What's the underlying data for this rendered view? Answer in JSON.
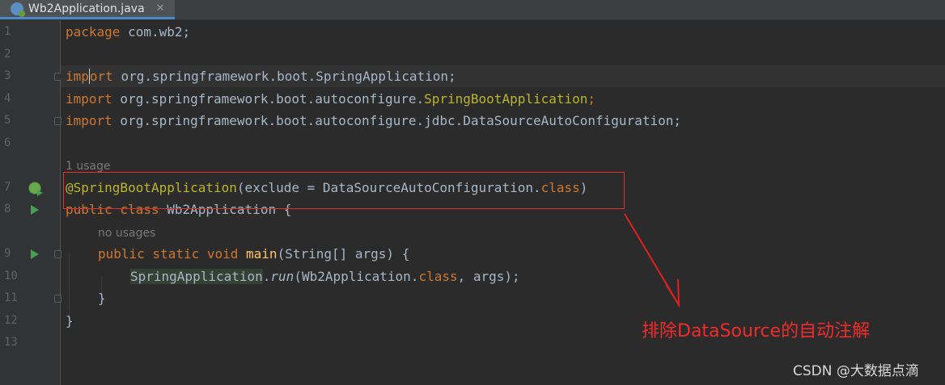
{
  "tab": {
    "title": "Wb2Application.java",
    "close": "✕",
    "icon": "java-class-icon"
  },
  "line_numbers": [
    "1",
    "2",
    "3",
    "4",
    "5",
    "6",
    "7",
    "8",
    "9",
    "10",
    "11",
    "12",
    "13"
  ],
  "code": {
    "l1": {
      "kw": "package",
      "rest": " com.wb2;"
    },
    "l3": {
      "kw_a": "imp",
      "kw_b": "ort",
      "rest": " org.springframework.boot.SpringApplication;"
    },
    "l4": {
      "kw": "import",
      "pre": " org.springframework.boot.autoconfigure.",
      "ann": "SpringBootApplication",
      "semi": ";"
    },
    "l5": {
      "kw": "import",
      "rest": " org.springframework.boot.autoconfigure.jdbc.DataSourceAutoConfiguration;"
    },
    "hint_usage": "1 usage",
    "l7": {
      "ann": "@SpringBootApplication",
      "pre": "(exclude = DataSourceAutoConfiguration.",
      "kw": "class",
      "post": ")"
    },
    "l8": {
      "kw": "public class",
      "rest": " Wb2Application {"
    },
    "hint_no_usages": "no usages",
    "l9": {
      "kw": "public static void",
      "fn": " main",
      "rest": "(String[] args) {"
    },
    "l10": {
      "cls": "SpringApplication",
      "dot": ".",
      "it": "run",
      "pre": "(Wb2Application.",
      "kw": "class",
      "post": ", args);"
    },
    "l11": "}",
    "l12": "}"
  },
  "annotation": {
    "text": "排除DataSource的自动注解",
    "color": "#ef2b2b"
  },
  "watermark": "CSDN @大数据点滴"
}
